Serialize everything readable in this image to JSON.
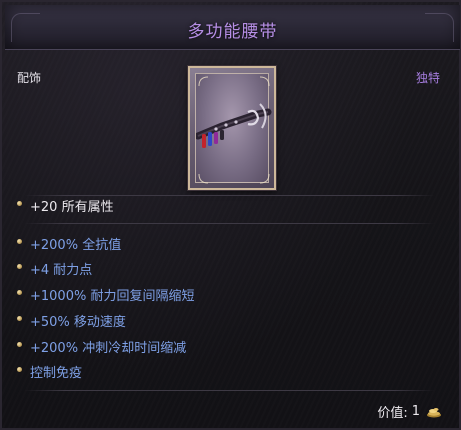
{
  "item": {
    "name": "多功能腰带",
    "type": "配饰",
    "rarity": "独特",
    "icon": "utility-belt-icon"
  },
  "base_stats": [
    {
      "text": "+20 所有属性"
    }
  ],
  "magic_stats": [
    {
      "text": "+200% 全抗值"
    },
    {
      "text": "+4 耐力点"
    },
    {
      "text": "+1000% 耐力回复间隔缩短"
    },
    {
      "text": "+50% 移动速度"
    },
    {
      "text": "+200% 冲刺冷却时间缩减"
    },
    {
      "text": "控制免疫"
    }
  ],
  "price": {
    "label": "价值:",
    "value": "1",
    "icon": "gold-coin-icon"
  },
  "colors": {
    "title": "#b78fe6",
    "rarity": "#a77ee0",
    "magic_stat": "#7ea0e6",
    "base_stat": "#ece9ee",
    "bullet": "#c9a75d"
  }
}
